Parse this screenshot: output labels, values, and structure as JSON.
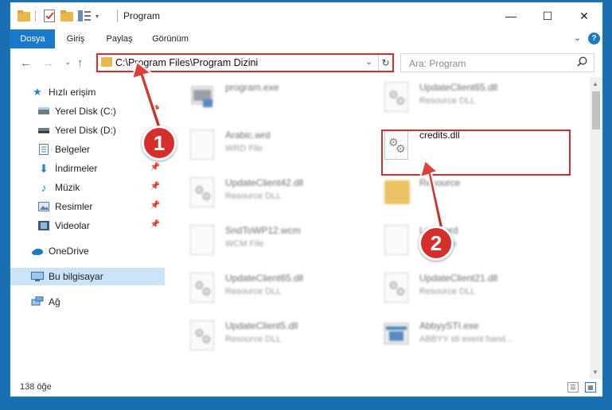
{
  "window": {
    "title": "Program",
    "controls": {
      "minimize": "—",
      "maximize": "☐",
      "close": "✕"
    }
  },
  "ribbon": {
    "tabs": [
      {
        "label": "Dosya",
        "active": true
      },
      {
        "label": "Giriş"
      },
      {
        "label": "Paylaş"
      },
      {
        "label": "Görünüm"
      }
    ],
    "expand": "⌄",
    "help": "?"
  },
  "address": {
    "path": "C:\\Program Files\\Program Dizini",
    "dropdown": "⌄",
    "refresh": "↻"
  },
  "search": {
    "placeholder": "Ara: Program",
    "icon": "search-icon"
  },
  "nav": {
    "back": "←",
    "forward": "→",
    "recent": "⌄",
    "up": "↑"
  },
  "sidebar": {
    "items": [
      {
        "label": "Hızlı erişim",
        "icon": "star-icon"
      },
      {
        "label": "Yerel Disk (C:)",
        "icon": "drive-icon"
      },
      {
        "label": "Yerel Disk (D:)",
        "icon": "drive-icon"
      },
      {
        "label": "Belgeler",
        "icon": "documents-icon"
      },
      {
        "label": "İndirmeler",
        "icon": "download-icon"
      },
      {
        "label": "Müzik",
        "icon": "music-icon"
      },
      {
        "label": "Resimler",
        "icon": "pictures-icon"
      },
      {
        "label": "Videolar",
        "icon": "videos-icon"
      },
      {
        "label": "OneDrive",
        "icon": "cloud-icon"
      },
      {
        "label": "Bu bilgisayar",
        "icon": "computer-icon",
        "selected": true
      },
      {
        "label": "Ağ",
        "icon": "network-icon"
      }
    ]
  },
  "files": [
    {
      "name": "program.exe",
      "type": "",
      "icon": "exe-icon"
    },
    {
      "name": "UpdateClient65.dll",
      "type": "Resource DLL",
      "icon": "dll-icon"
    },
    {
      "name": "Arabic.wrd",
      "type": "WRD File",
      "icon": "file-icon"
    },
    {
      "name": "credits.dll",
      "type": "",
      "icon": "dll-icon"
    },
    {
      "name": "UpdateClient42.dll",
      "type": "Resource DLL",
      "icon": "dll-icon"
    },
    {
      "name": "Resource",
      "type": "",
      "icon": "folder-icon"
    },
    {
      "name": "SndToWP12.wcm",
      "type": "WCM File",
      "icon": "file-icon"
    },
    {
      "name": "Latin.wrd",
      "type": "WRD File",
      "icon": "file-icon"
    },
    {
      "name": "UpdateClient65.dll",
      "type": "Resource DLL",
      "icon": "dll-icon"
    },
    {
      "name": "UpdateClient21.dll",
      "type": "Resource DLL",
      "icon": "dll-icon"
    },
    {
      "name": "UpdateClient5.dll",
      "type": "Resource DLL",
      "icon": "dll-icon"
    },
    {
      "name": "AbbyySTI.exe",
      "type": "ABBYY sti event hand...",
      "icon": "exe-icon"
    }
  ],
  "status": {
    "count": "138 öğe"
  },
  "annotations": {
    "step1": "1",
    "step2": "2"
  },
  "colors": {
    "accent": "#1979ca",
    "highlight": "#d62d2d",
    "selection": "#cce4f7"
  }
}
